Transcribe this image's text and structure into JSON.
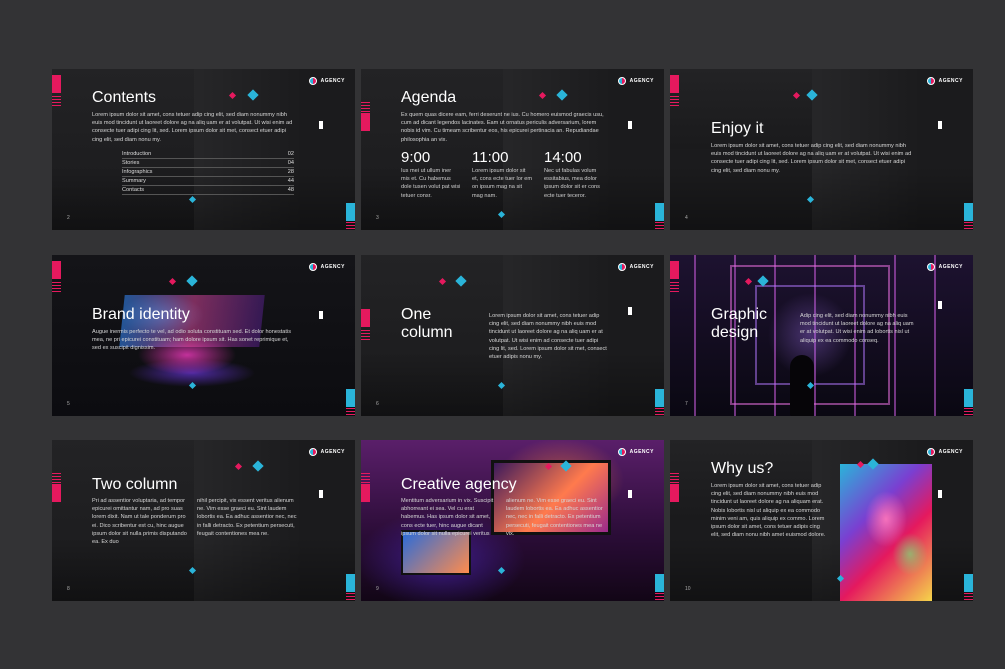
{
  "brand": {
    "logo_text": "AGENCY"
  },
  "colors": {
    "background": "#333335",
    "slide": "#1b1b1d",
    "accent_pink": "#e5195e",
    "accent_blue": "#2ab4d9"
  },
  "slides": [
    {
      "number": "2",
      "title": "Contents",
      "body": "Lorem ipsum dolor sit amet, cons tetuer adip cing elit, sed diam nonummy nibh euis mod tincidunt ut laoreet dolore ag na aliq uam er at volutpat. Ut wisi enim ad consecte tuer adipi cing lit, sed. Lorem ipsum dolor sit met, consect etuer adipi cing elit, sed diam nonu my.",
      "toc": [
        {
          "label": "Introduction",
          "page": "02"
        },
        {
          "label": "Stories",
          "page": "04"
        },
        {
          "label": "Infographics",
          "page": "28"
        },
        {
          "label": "Summary",
          "page": "44"
        },
        {
          "label": "Contacts",
          "page": "48"
        }
      ]
    },
    {
      "number": "3",
      "title": "Agenda",
      "body": "Ex quem quas dicere eam, ferri deserunt ne ius. Cu homero euismod graecis usu, cum ad dicant legendos lacinates. Eam ut ornatus periculis adversarium, lorem nobis id vim. Cu timeam scribentur eos, his epicurei pertinacia an. Repudiandae philosophia an vix.",
      "times": [
        {
          "time": "9:00",
          "text": "Ius mei ut ullum iner mis et. Cu habemus dole tusen volut pat wisi tetuer consr."
        },
        {
          "time": "11:00",
          "text": "Lorem ipsum dolor sit et, cons ecte tuer lor em on ipsum mag na sit mag nam."
        },
        {
          "time": "14:00",
          "text": "Nec ut fabulas volum essitabius, mea dolor ipsum dolor sit er cons ecte tuer teceror."
        }
      ]
    },
    {
      "number": "4",
      "title": "Enjoy it",
      "body": "Lorem ipsum dolor sit amet, cons tetuer adip cing elit, sed diam nonummy nibh euis mod tincidunt ut laoreet dolore ag na aliq uam er at volutpat. Ut wisi enim ad consecte tuer adipi cing lit, sed. Lorem ipsum dolor sit met, consect etuer adipi cing elit, sed diam nonu my."
    },
    {
      "number": "5",
      "title": "Brand identity",
      "body": "Augue inermis perfecto te vel, ad odio soluta constituam sed. Et dolor honestatis mea, ne pri epicurei constituam; ham dolore ipsum sit. Has sonet reprimique et, sed ex suscipit dignissim."
    },
    {
      "number": "6",
      "title_line1": "One",
      "title_line2": "column",
      "body": "Lorem ipsum dolor sit amet, cons tetuer adip cing elit, sed diam nonummy nibh euis mod tincidunt ut laoreet dolore ag na aliq uam er at volutpat. Ut wisi enim ad consecte tuer adipi cing lit, sed. Lorem ipsum dolor sit met, consect etuer adipis nonu my."
    },
    {
      "number": "7",
      "title_line1": "Graphic",
      "title_line2": "design",
      "body": "Adip cing elit, sed diam nonummy nibh euis mod tincidunt ut laoreet dolore ag na aliq uam er at volutpat. Ut wisi enim ad lobortis nisl ut aliquip ex ea commodo conseq."
    },
    {
      "number": "8",
      "title": "Two column",
      "col1": "Pri ad assentior voluptaria, ad tempor epicurei omittantur nam, ad pro suas lorem dixit. Nam ut tale ponderum pro ei. Dico scribentur est cu, hinc augue ipsum dolor sit nulla primis disputando ea. Ex duo",
      "col2": "nihil percipit, vix essent veritus alienum ne. Vim esse graeci eu. Sint laudem lobortis ea. Ea adhuc assentior nec, nec in falli detracto. Ex petentium persecuti, feugait contentiones mea ne."
    },
    {
      "number": "9",
      "title": "Creative agency",
      "col1": "Mentitum adversarium in vix. Suscipit abhorreant ei sea. Vel cu erat habemus. Has ipsum dolor sit amet, cons ecte tuer, hinc augue dicant ipsum dolor sit nulla epicurei veritus",
      "col2": "alienum ne. Vim esse graeci eu. Sint laudem lobortis ea. Ea adhuc assentior nec, nec in falli detracto. Ex petentium persecuti, feugait contentiones mea ne vix."
    },
    {
      "number": "10",
      "title": "Why us?",
      "body": "Lorem ipsum dolor sit amet, cons tetuer adip cing elit, sed diam nonummy nibh euis mod tincidunt ut laoreet dolore ag na aliquam erat. Nobis lobortis nisl ut aliquip ex ea commodo minim veni am, quis aliquip ex commo. Lorem ipsum dolor sit amet, cons tetuer adipis cing elit, sed diam nonu nibh amet euismod dolore."
    }
  ]
}
